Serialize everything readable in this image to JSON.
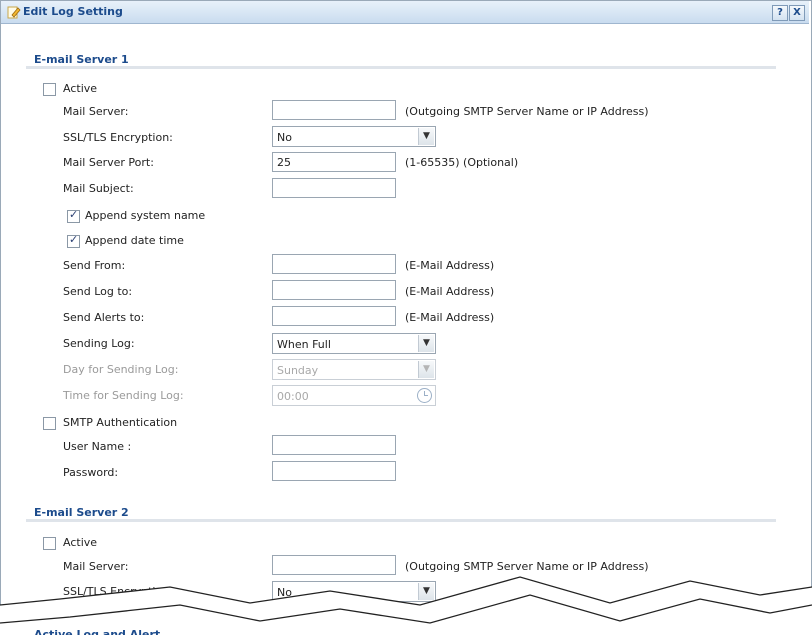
{
  "window": {
    "title": "Edit Log Setting",
    "help_label": "?",
    "close_label": "X"
  },
  "server1": {
    "heading": "E-mail Server 1",
    "active_label": "Active",
    "mail_server_label": "Mail Server:",
    "mail_server_value": "",
    "mail_server_hint": "(Outgoing SMTP Server Name or IP Address)",
    "ssl_label": "SSL/TLS Encryption:",
    "ssl_value": "No",
    "port_label": "Mail Server Port:",
    "port_value": "25",
    "port_hint": "(1-65535) (Optional)",
    "subject_label": "Mail Subject:",
    "subject_value": "",
    "append_system_label": "Append system name",
    "append_date_label": "Append date time",
    "send_from_label": "Send From:",
    "send_log_to_label": "Send Log to:",
    "send_alerts_to_label": "Send Alerts to:",
    "email_hint": "(E-Mail Address)",
    "sending_log_label": "Sending Log:",
    "sending_log_value": "When Full",
    "day_label": "Day for Sending Log:",
    "day_value": "Sunday",
    "time_label": "Time for Sending Log:",
    "time_value": "00:00",
    "smtp_auth_label": "SMTP Authentication",
    "username_label": "User Name :",
    "password_label": "Password:"
  },
  "server2": {
    "heading": "E-mail Server 2",
    "active_label": "Active",
    "mail_server_label": "Mail Server:",
    "mail_server_hint": "(Outgoing SMTP Server Name or IP Address)",
    "ssl_label": "SSL/TLS Encryption:",
    "ssl_value": "No"
  },
  "cut_section": {
    "heading": "Active Log and Alert"
  },
  "icons": {
    "title": "edit-pencil-icon",
    "dropdown": "chevron-down-icon",
    "time": "clock-icon"
  }
}
